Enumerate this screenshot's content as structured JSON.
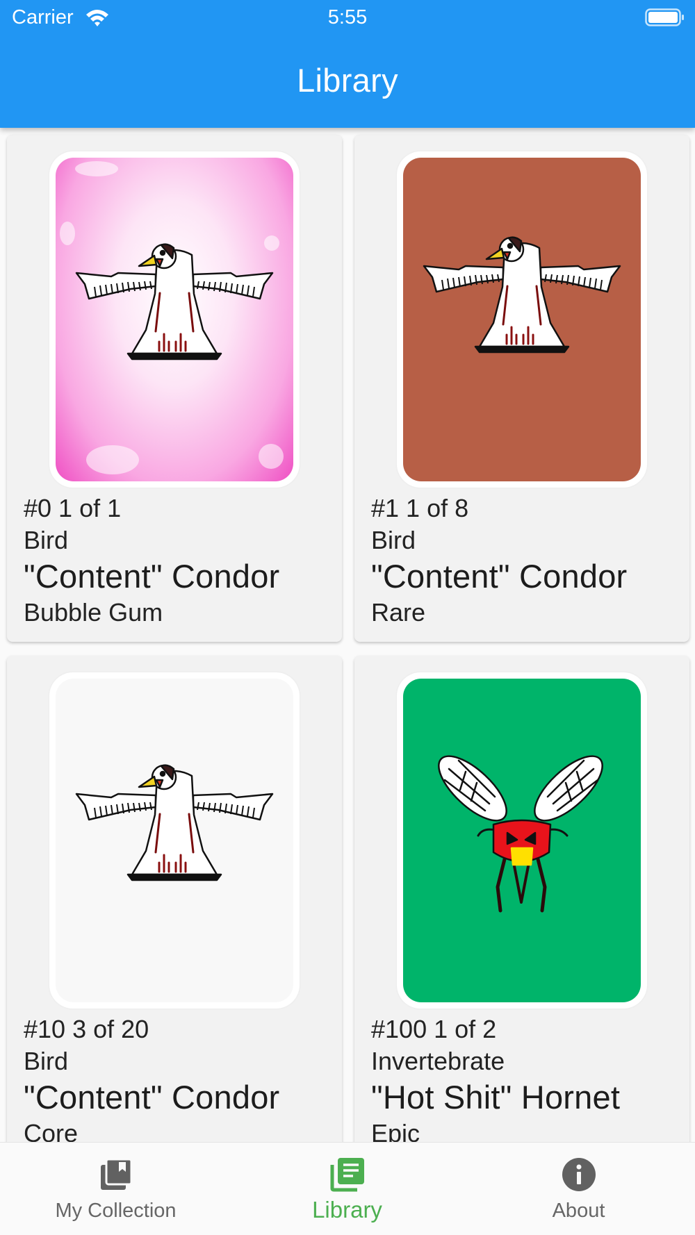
{
  "status_bar": {
    "carrier": "Carrier",
    "time": "5:55"
  },
  "header": {
    "title": "Library"
  },
  "cards": [
    {
      "id_line": "#0 1 of 1",
      "category": "Bird",
      "name": "\"Content\" Condor",
      "variant": "Bubble Gum",
      "background": "pink-bubble",
      "creature_icon": "condor-icon"
    },
    {
      "id_line": "#1 1 of 8",
      "category": "Bird",
      "name": "\"Content\" Condor",
      "variant": "Rare",
      "background": "#b75f46",
      "creature_icon": "condor-icon"
    },
    {
      "id_line": "#10 3 of 20",
      "category": "Bird",
      "name": "\"Content\" Condor",
      "variant": "Core",
      "background": "#f8f8f8",
      "creature_icon": "condor-icon"
    },
    {
      "id_line": "#100 1 of 2",
      "category": "Invertebrate",
      "name": "\"Hot Shit\" Hornet",
      "variant": "Epic",
      "background": "#00b46a",
      "creature_icon": "hornet-icon"
    }
  ],
  "bottom_nav": {
    "items": [
      {
        "label": "My Collection",
        "icon": "collection-icon",
        "active": false
      },
      {
        "label": "Library",
        "icon": "library-icon",
        "active": true
      },
      {
        "label": "About",
        "icon": "info-icon",
        "active": false
      }
    ]
  },
  "colors": {
    "app_bar": "#2196F3",
    "active_nav": "#4caf50",
    "inactive_nav": "#666666"
  }
}
